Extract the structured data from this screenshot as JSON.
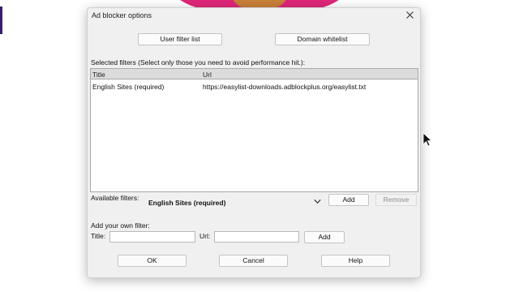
{
  "dialog": {
    "title": "Ad blocker options",
    "user_filter_list_label": "User filter list",
    "domain_whitelist_label": "Domain whitelist",
    "selected_filters_caption": "Selected filters (Select only those you need to avoid performance hit.):",
    "table": {
      "columns": [
        "Title",
        "Url"
      ],
      "rows": [
        {
          "title": "English Sites (required)",
          "url": "https://easylist-downloads.adblockplus.org/easylist.txt"
        }
      ]
    },
    "available_filters_label": "Available filters:",
    "available_filters_selected": "English Sites (required)",
    "add_label": "Add",
    "remove_label": "Remove",
    "own_filter_caption": "Add your own filter:",
    "title_field_label": "Title:",
    "url_field_label": "Url:",
    "title_field_value": "",
    "url_field_value": "",
    "add_own_label": "Add",
    "ok_label": "OK",
    "cancel_label": "Cancel",
    "help_label": "Help"
  },
  "colors": {
    "accent_left": "#3a1d6e",
    "background_blob": "#e0267a"
  },
  "icons": {
    "close": "close-icon",
    "dropdown": "chevron-down-icon",
    "cursor": "mouse-pointer-icon"
  }
}
